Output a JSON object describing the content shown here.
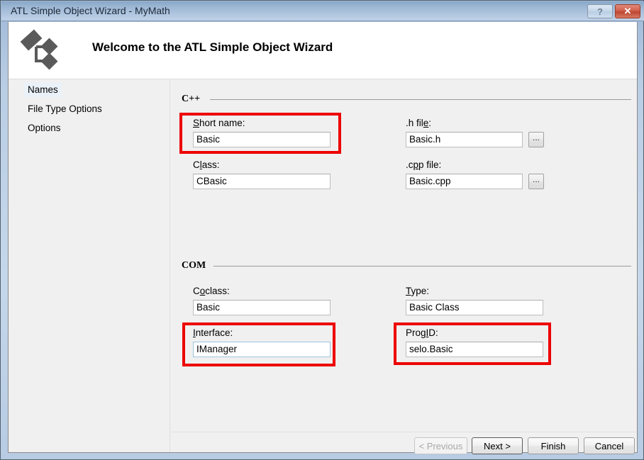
{
  "window": {
    "title": "ATL Simple Object Wizard - MyMath",
    "help_button": "?",
    "close_button": "✕",
    "frame_color": "#b9cde4",
    "annotation_color": "#ed0000"
  },
  "header": {
    "logo_icon": "wizard-diagram-logo",
    "title": "Welcome to the ATL Simple Object Wizard"
  },
  "sidebar": {
    "items": [
      {
        "label": "Names",
        "selected": true
      },
      {
        "label": "File Type Options",
        "selected": false
      },
      {
        "label": "Options",
        "selected": false
      }
    ]
  },
  "groups": {
    "cpp": {
      "label": "C++",
      "fields": {
        "short_name": {
          "label_pre": "",
          "label_accel": "S",
          "label_post": "hort name:",
          "value": "Basic",
          "highlighted": true
        },
        "class": {
          "label_pre": "C",
          "label_accel": "l",
          "label_post": "ass:",
          "value": "CBasic",
          "highlighted": false
        },
        "h_file": {
          "label_pre": ".h fil",
          "label_accel": "e",
          "label_post": ":",
          "value": "Basic.h",
          "browse_label": "...",
          "highlighted": false
        },
        "cpp_file": {
          "label_pre": ".c",
          "label_accel": "p",
          "label_post": "p file:",
          "value": "Basic.cpp",
          "browse_label": "...",
          "highlighted": false
        }
      }
    },
    "com": {
      "label": "COM",
      "fields": {
        "coclass": {
          "label_pre": "C",
          "label_accel": "o",
          "label_post": "class:",
          "value": "Basic",
          "highlighted": false
        },
        "interface": {
          "label_pre": "",
          "label_accel": "I",
          "label_post": "nterface:",
          "value": "IManager",
          "highlighted": true,
          "focused": true
        },
        "type": {
          "label_pre": "",
          "label_accel": "T",
          "label_post": "ype:",
          "value": "Basic Class",
          "highlighted": false
        },
        "progid": {
          "label_pre": "Prog",
          "label_accel": "I",
          "label_post": "D:",
          "value": "selo.Basic",
          "highlighted": true
        }
      }
    }
  },
  "footer": {
    "buttons": [
      {
        "label": "< Previous",
        "disabled": true,
        "default": false
      },
      {
        "label": "Next >",
        "disabled": false,
        "default": true
      },
      {
        "label": "Finish",
        "disabled": false,
        "default": false
      },
      {
        "label": "Cancel",
        "disabled": false,
        "default": false
      }
    ]
  }
}
